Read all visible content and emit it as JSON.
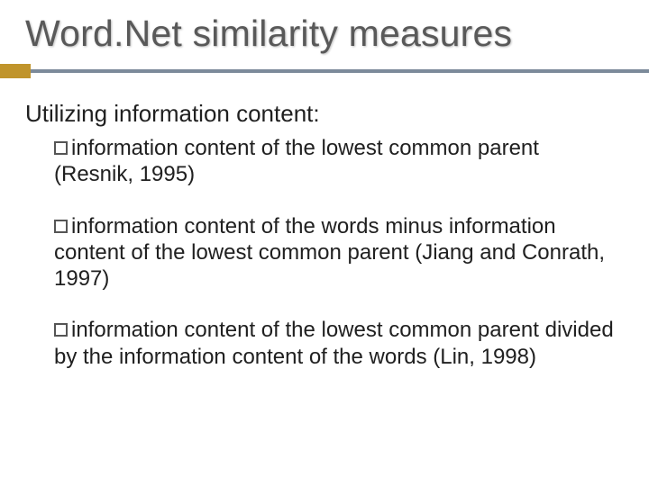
{
  "title": "Word.Net similarity measures",
  "section_heading": "Utilizing information content:",
  "bullets": [
    {
      "text": "information content of the lowest common parent (Resnik, 1995)"
    },
    {
      "text": "information content of the words minus information content of the lowest common parent (Jiang and Conrath, 1997)"
    },
    {
      "text": "information content of the lowest common parent divided by the information content of the words (Lin, 1998)"
    }
  ]
}
